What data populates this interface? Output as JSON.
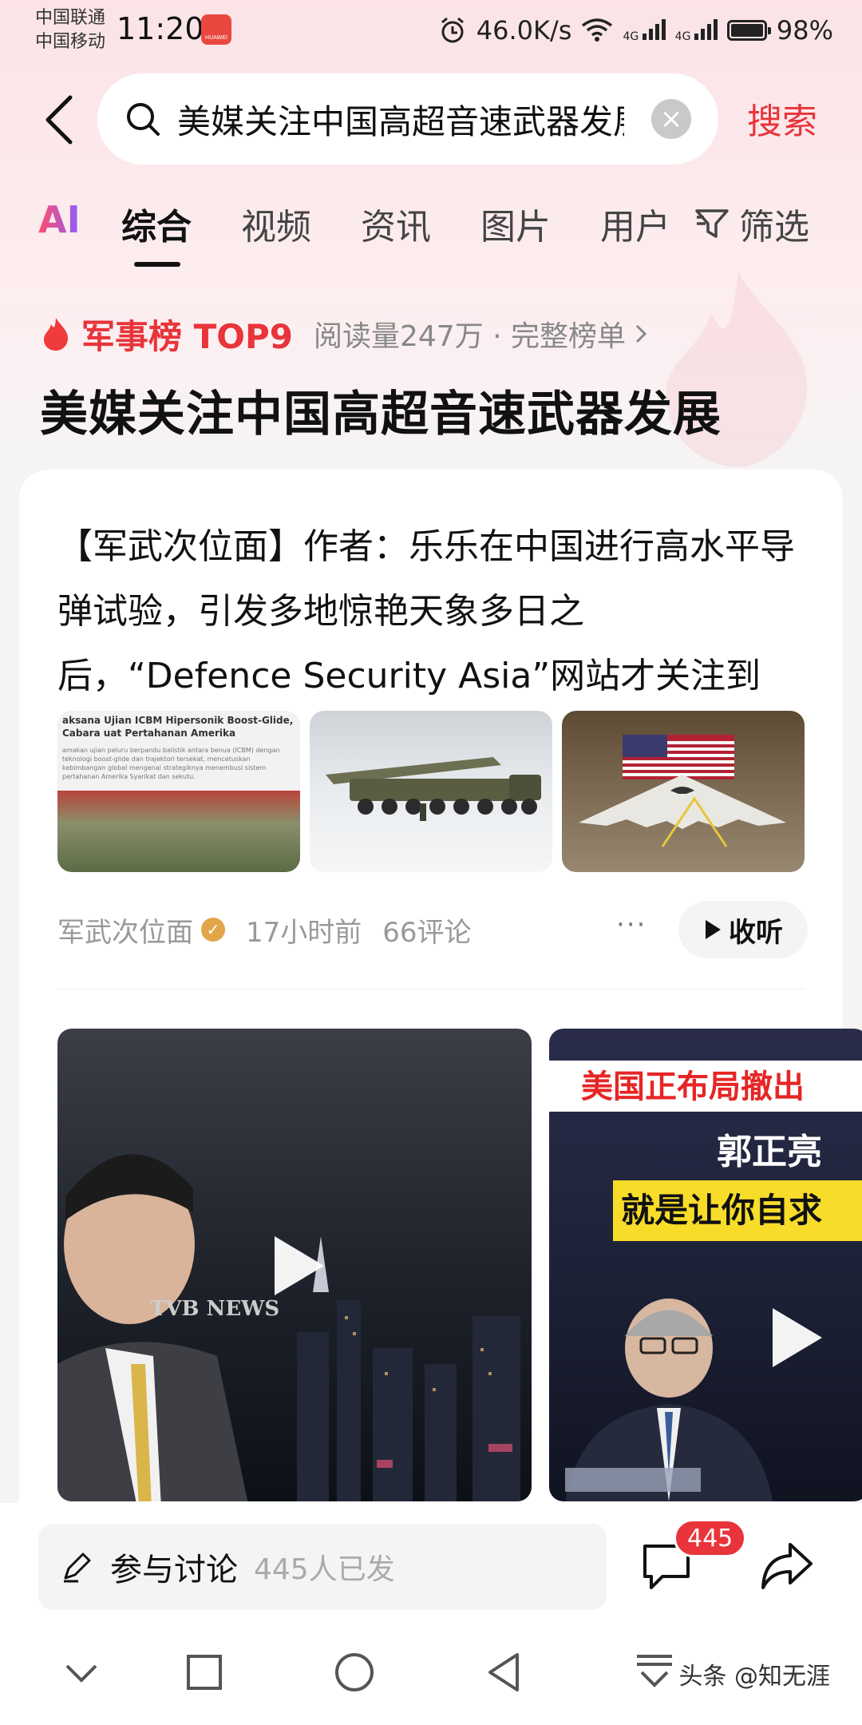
{
  "status_bar": {
    "carrier_1": "中国联通",
    "carrier_2": "中国移动",
    "time": "11:20",
    "app_badge": "HUAWEI",
    "network_speed": "46.0K/s",
    "signal_1": "4G",
    "signal_2": "4G",
    "battery": "98%"
  },
  "search": {
    "query": "美媒关注中国高超音速武器发展",
    "button_label": "搜索"
  },
  "tabs": [
    {
      "label": "AI"
    },
    {
      "label": "综合",
      "active": true
    },
    {
      "label": "视频"
    },
    {
      "label": "资讯"
    },
    {
      "label": "图片"
    },
    {
      "label": "用户"
    }
  ],
  "filter_label": "筛选",
  "ranking": {
    "title": "军事榜 TOP9",
    "meta": "阅读量247万 · 完整榜单"
  },
  "topic_title": "美媒关注中国高超音速武器发展",
  "article": {
    "summary": "【军武次位面】作者：乐乐在中国进行高水平导弹试验，引发多地惊艳天象多日之后，“Defence Security Asia”网站才关注到这…",
    "thumb_1_headline": "aksana Ujian ICBM Hipersonik Boost-Glide, Cabara uat Pertahanan Amerika",
    "thumb_1_body": "amakan ujian peluru berpandu balistik antara benua (ICBM) dengan teknologi boost-glide dan trajektori tersekat, mencetuskan kebimbangan global mengenai strategiknya menembusi sistem pertahanan Amerika Syarikat dan sekutu.",
    "author": "军武次位面",
    "time_ago": "17小时前",
    "comments": "66评论",
    "listen_label": "收听"
  },
  "videos": [
    {
      "overlay_text": "TVB NEWS"
    },
    {
      "banner_1": "美国正布局撤出",
      "banner_2": "郭正亮",
      "banner_3": "就是让你自求"
    }
  ],
  "bottom_bar": {
    "discuss_label": "参与讨论",
    "discuss_count": "445人已发",
    "comment_badge": "445"
  },
  "watermark": "头条 @知无涯",
  "colors": {
    "accent": "#e8343a",
    "background": "#f6f3f4",
    "header_tint": "#fbe3e6"
  }
}
